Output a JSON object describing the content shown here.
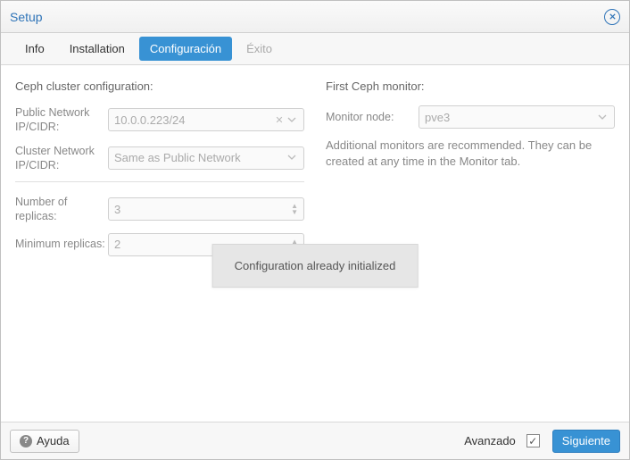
{
  "window": {
    "title": "Setup"
  },
  "tabs": {
    "info": "Info",
    "installation": "Installation",
    "config": "Configuración",
    "exit": "Éxito"
  },
  "left": {
    "heading": "Ceph cluster configuration:",
    "public_label": "Public Network IP/CIDR:",
    "public_value": "10.0.0.223/24",
    "cluster_label": "Cluster Network IP/CIDR:",
    "cluster_placeholder": "Same as Public Network",
    "replicas_label": "Number of replicas:",
    "replicas_value": "3",
    "min_label": "Minimum replicas:",
    "min_value": "2"
  },
  "right": {
    "heading": "First Ceph monitor:",
    "mon_label": "Monitor node:",
    "mon_value": "pve3",
    "help": "Additional monitors are recommended. They can be created at any time in the Monitor tab."
  },
  "overlay": "Configuration already initialized",
  "footer": {
    "help": "Ayuda",
    "advanced": "Avanzado",
    "next": "Siguiente"
  }
}
